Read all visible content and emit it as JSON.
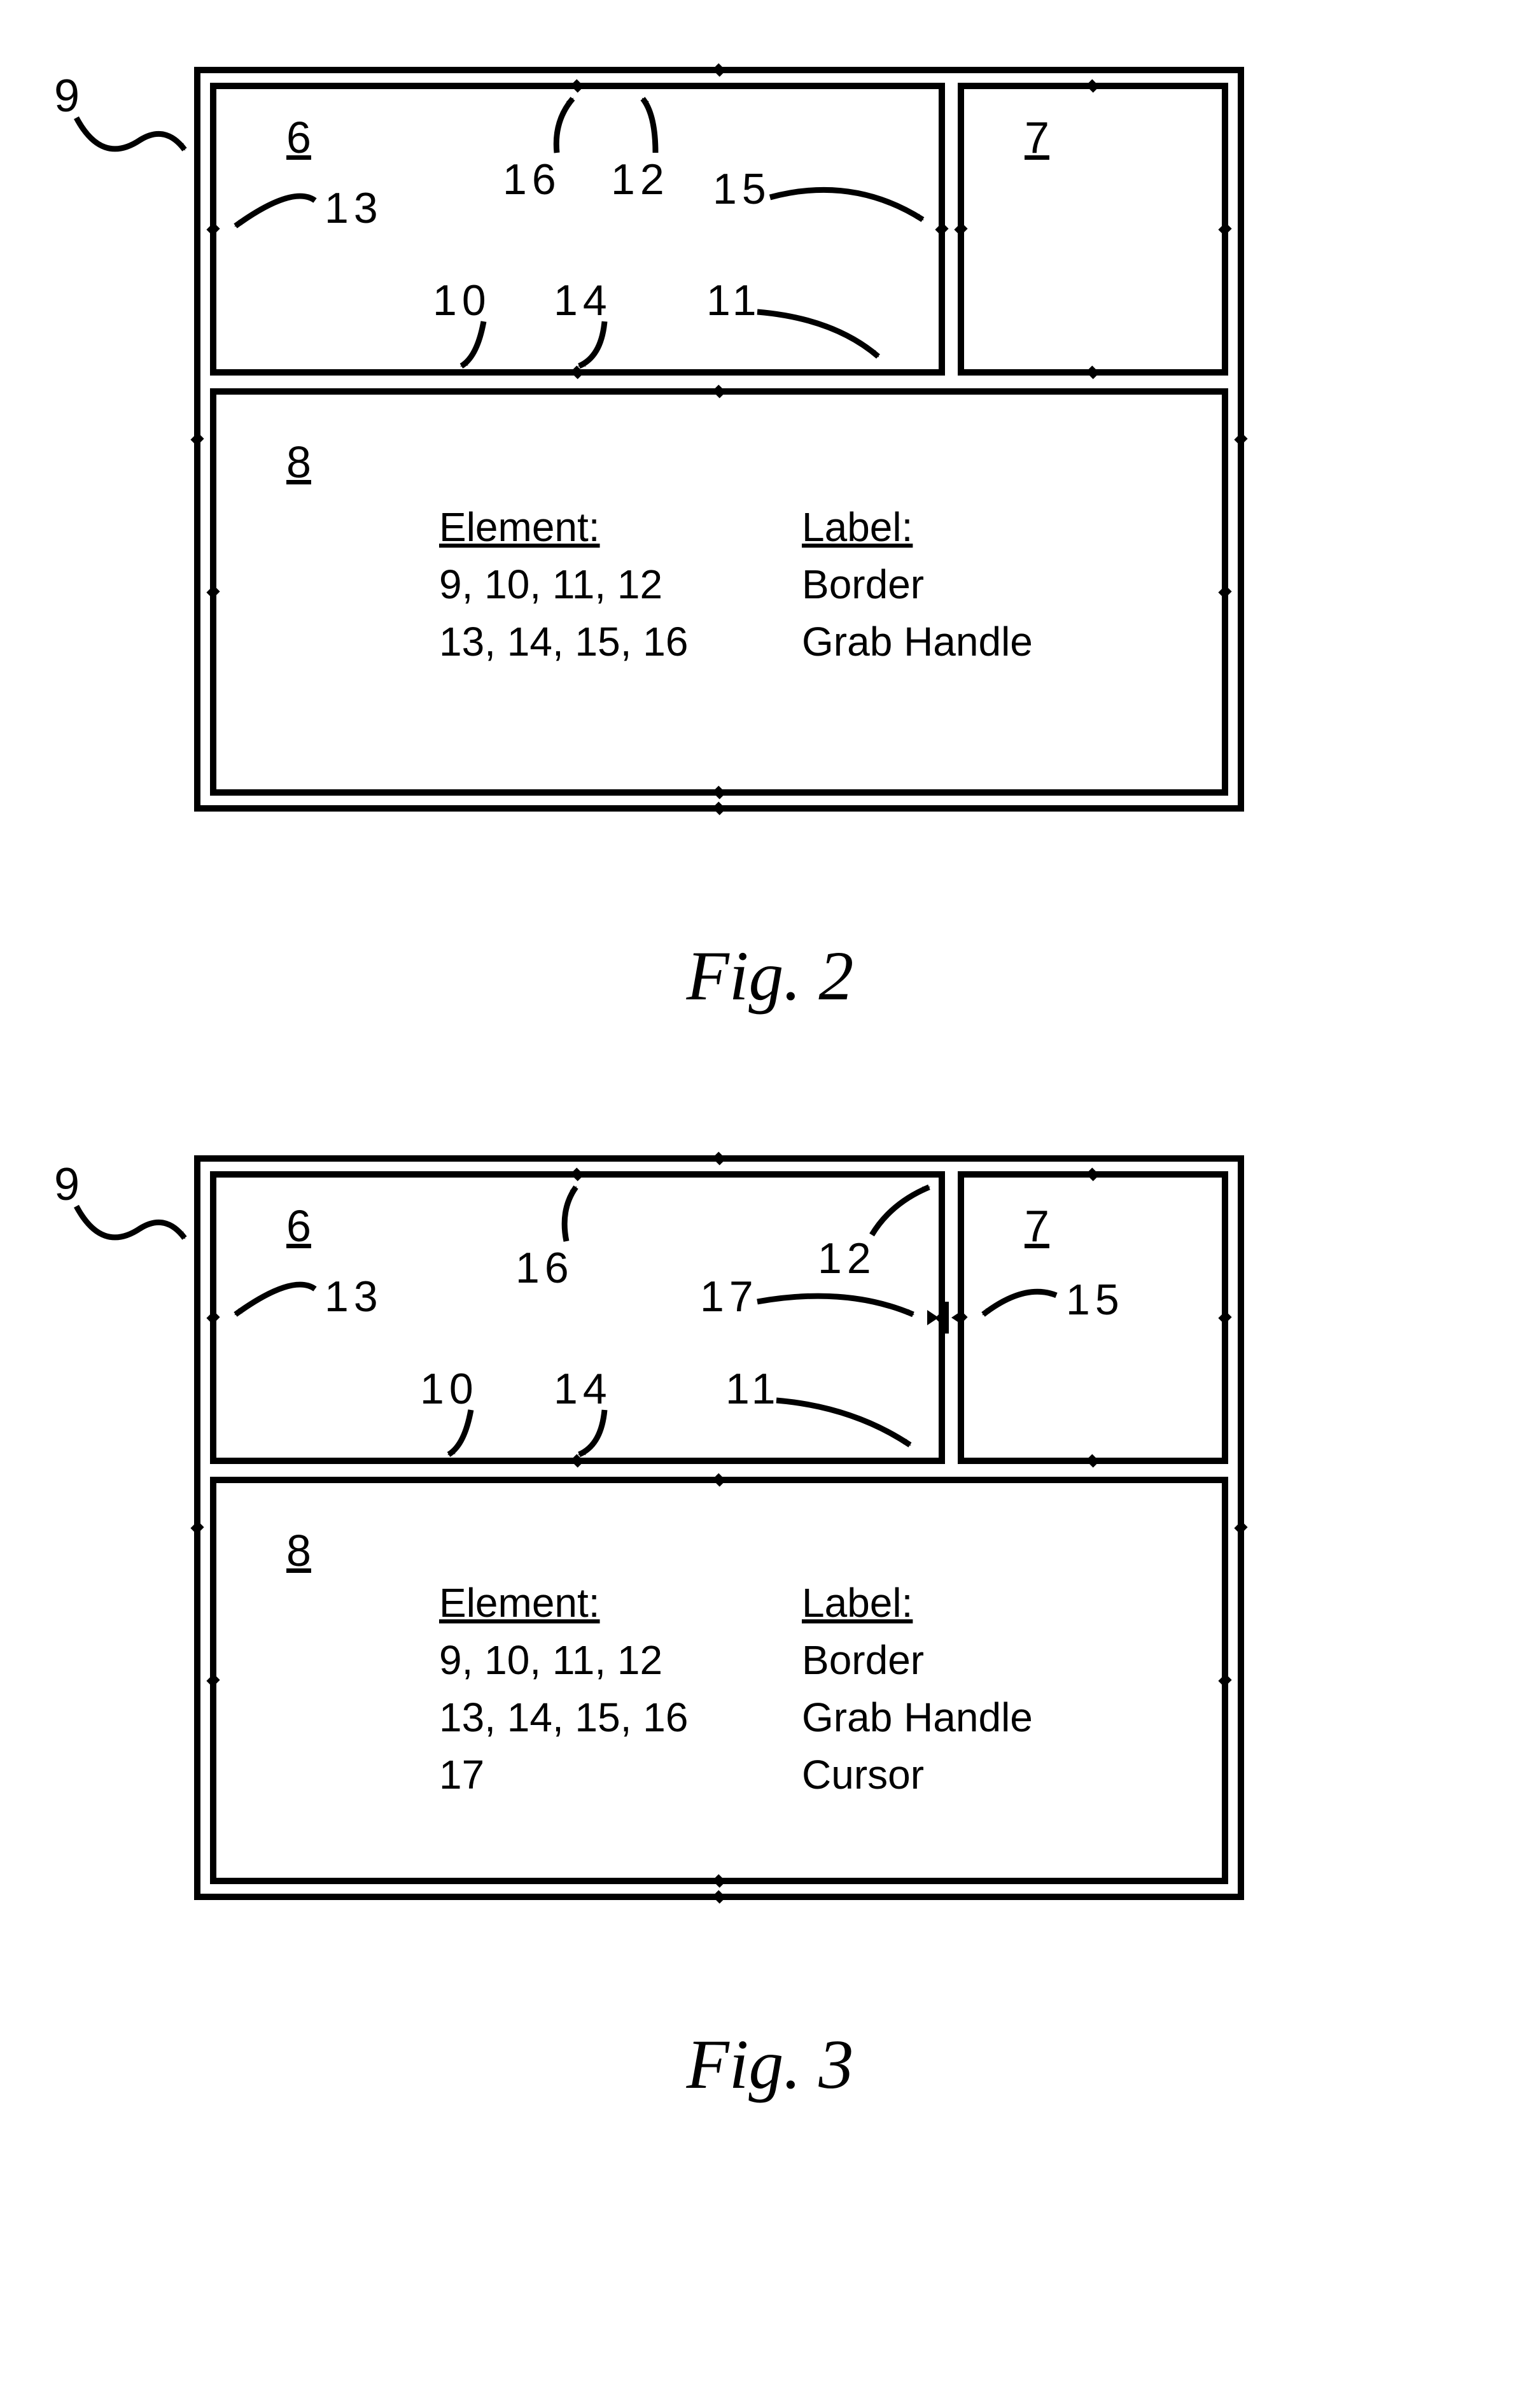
{
  "fig2": {
    "caption": "Fig. 2",
    "outerLabel": "9",
    "panes": {
      "topLeft": "6",
      "topRight": "7",
      "bottom": "8"
    },
    "callouts": {
      "left": "13",
      "topA": "16",
      "topB": "12",
      "right": "15",
      "bottomA": "10",
      "bottomB": "14",
      "bottomC": "11"
    },
    "legend": {
      "headerElement": "Element:",
      "headerLabel": "Label:",
      "rows": [
        {
          "element": "9, 10, 11, 12",
          "label": "Border"
        },
        {
          "element": "13, 14, 15, 16",
          "label": "Grab Handle"
        }
      ]
    }
  },
  "fig3": {
    "caption": "Fig. 3",
    "outerLabel": "9",
    "panes": {
      "topLeft": "6",
      "topRight": "7",
      "bottom": "8"
    },
    "callouts": {
      "left": "13",
      "topA": "16",
      "cursor": "17",
      "topB": "12",
      "right": "15",
      "bottomA": "10",
      "bottomB": "14",
      "bottomC": "11"
    },
    "legend": {
      "headerElement": "Element:",
      "headerLabel": "Label:",
      "rows": [
        {
          "element": "9, 10, 11, 12",
          "label": "Border"
        },
        {
          "element": "13, 14, 15, 16",
          "label": "Grab Handle"
        },
        {
          "element": "17",
          "label": "Cursor"
        }
      ]
    }
  }
}
